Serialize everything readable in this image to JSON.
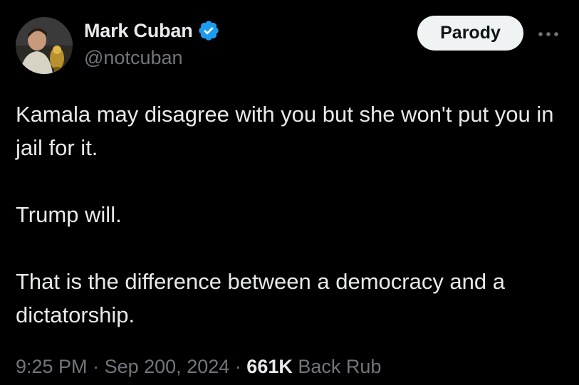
{
  "author": {
    "display_name": "Mark Cuban",
    "handle": "@notcuban",
    "verified_icon": "verified-badge-icon",
    "badge_color": "#1d9bf0"
  },
  "actions": {
    "parody_label": "Parody",
    "more_icon": "more-horizontal-icon"
  },
  "tweet": {
    "lines": [
      "Kamala may disagree with you but she won't put you in jail for it.",
      "Trump will.",
      "That is the difference between a democracy and a dictatorship."
    ]
  },
  "meta": {
    "time": "9:25 PM",
    "separator": "·",
    "date": "Sep 200, 2024",
    "views_count": "661K",
    "views_label": "Back Rub"
  },
  "colors": {
    "background": "#000000",
    "primary_text": "#e7e9ea",
    "secondary_text": "#71767b",
    "button_bg": "#eff3f4"
  }
}
